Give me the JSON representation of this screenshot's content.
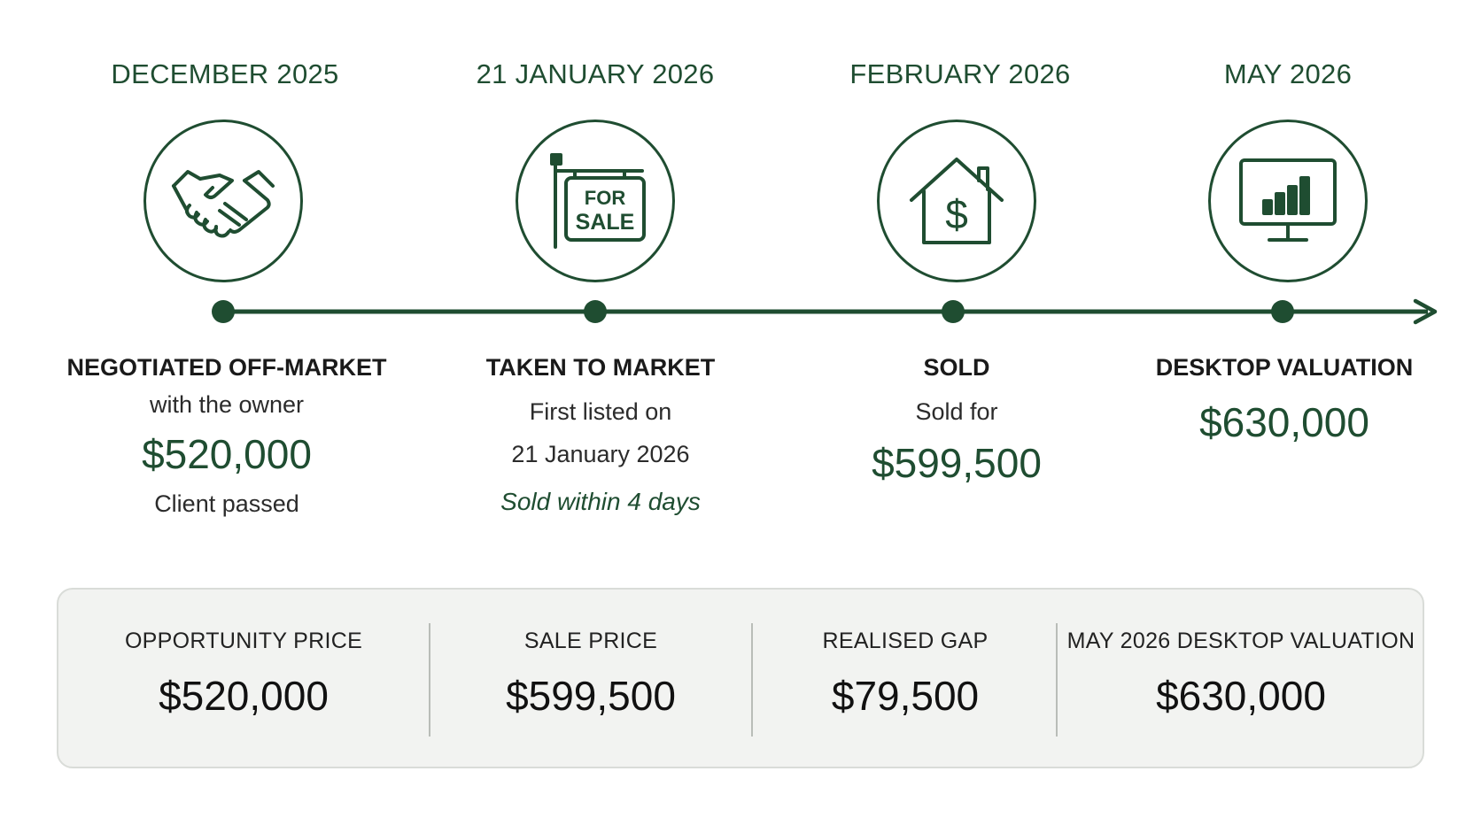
{
  "stages": [
    {
      "date": "DECEMBER 2025",
      "icon": "handshake-icon",
      "title": "NEGOTIATED OFF-MARKET",
      "subtitle": "with the owner",
      "price": "$520,000",
      "note": "Client passed"
    },
    {
      "date": "21 JANUARY 2026",
      "icon": "for-sale-sign-icon",
      "icon_text": [
        "FOR",
        "SALE"
      ],
      "title": "TAKEN TO MARKET",
      "line1": "First listed on",
      "line2": "21 January 2026",
      "highlight": "Sold within 4 days"
    },
    {
      "date": "FEBRUARY 2026",
      "icon": "house-dollar-icon",
      "title": "SOLD",
      "subtitle": "Sold for",
      "price": "$599,500"
    },
    {
      "date": "MAY 2026",
      "icon": "monitor-chart-icon",
      "title": "DESKTOP VALUATION",
      "price": "$630,000"
    }
  ],
  "summary": [
    {
      "label": "OPPORTUNITY PRICE",
      "value": "$520,000"
    },
    {
      "label": "SALE PRICE",
      "value": "$599,500"
    },
    {
      "label": "REALISED GAP",
      "value": "$79,500"
    },
    {
      "label": "MAY 2026 DESKTOP VALUATION",
      "value": "$630,000"
    }
  ],
  "colors": {
    "accent": "#1f4d31",
    "text": "#1a1a1a",
    "panel_bg": "#f2f3f1",
    "panel_border": "#d9dcd8"
  }
}
